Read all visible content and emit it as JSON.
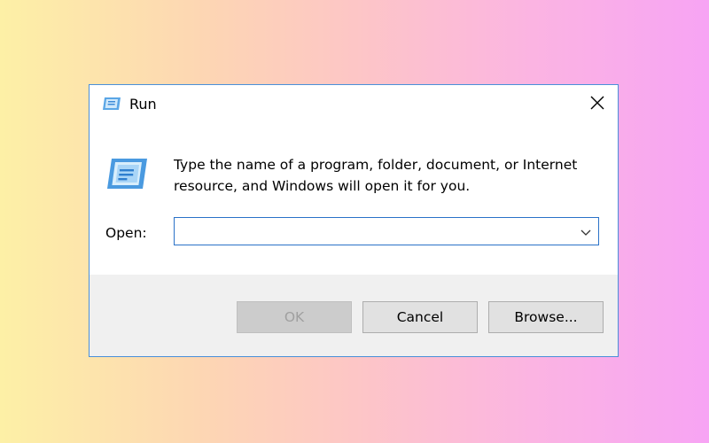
{
  "window": {
    "title": "Run",
    "title_icon": "run-icon",
    "close_icon": "close-icon"
  },
  "content": {
    "icon": "run-icon",
    "message": "Type the name of a program, folder, document, or Internet resource, and Windows will open it for you.",
    "open_label": "Open:",
    "open_value": "",
    "dropdown_icon": "chevron-down-icon"
  },
  "buttons": {
    "ok_label": "OK",
    "ok_disabled": true,
    "cancel_label": "Cancel",
    "browse_label": "Browse..."
  },
  "colors": {
    "accent": "#2a72c8",
    "window_border": "#4a90d9",
    "footer_bg": "#f0f0f0"
  }
}
